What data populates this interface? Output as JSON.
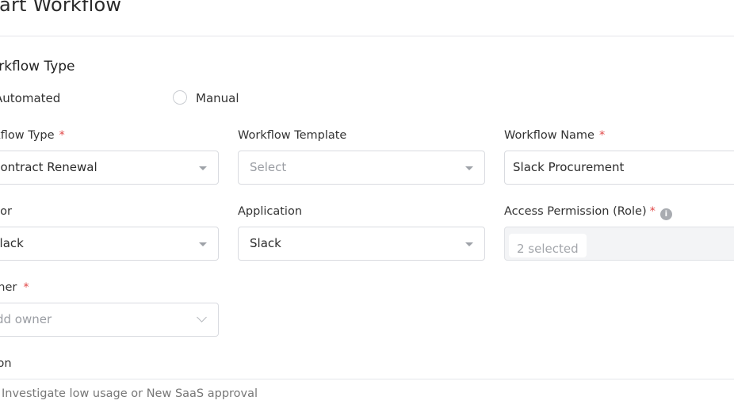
{
  "page": {
    "title": "Start Workflow"
  },
  "workflow_type_section": {
    "title": "Workflow Type",
    "options": [
      {
        "label": "Automated"
      },
      {
        "label": "Manual"
      }
    ]
  },
  "form": {
    "type": {
      "label": "Workflow Type",
      "value": "Contract Renewal"
    },
    "template": {
      "label": "Workflow Template",
      "placeholder": "Select"
    },
    "name": {
      "label": "Workflow Name",
      "value": "Slack Procurement"
    },
    "vendor": {
      "label": "Vendor",
      "value": "Slack"
    },
    "application": {
      "label": "Application",
      "value": "Slack"
    },
    "access": {
      "label": "Access Permission (Role)",
      "chip": "2 selected",
      "info_glyph": "i"
    },
    "owner": {
      "label": "Owner",
      "placeholder": "Add owner"
    },
    "description": {
      "label": "Description",
      "hint": "Investigate low usage or New SaaS approval"
    }
  },
  "colors": {
    "required": "#e04848",
    "border": "#d9dbe0",
    "disabled_bg": "#f3f4f6"
  }
}
